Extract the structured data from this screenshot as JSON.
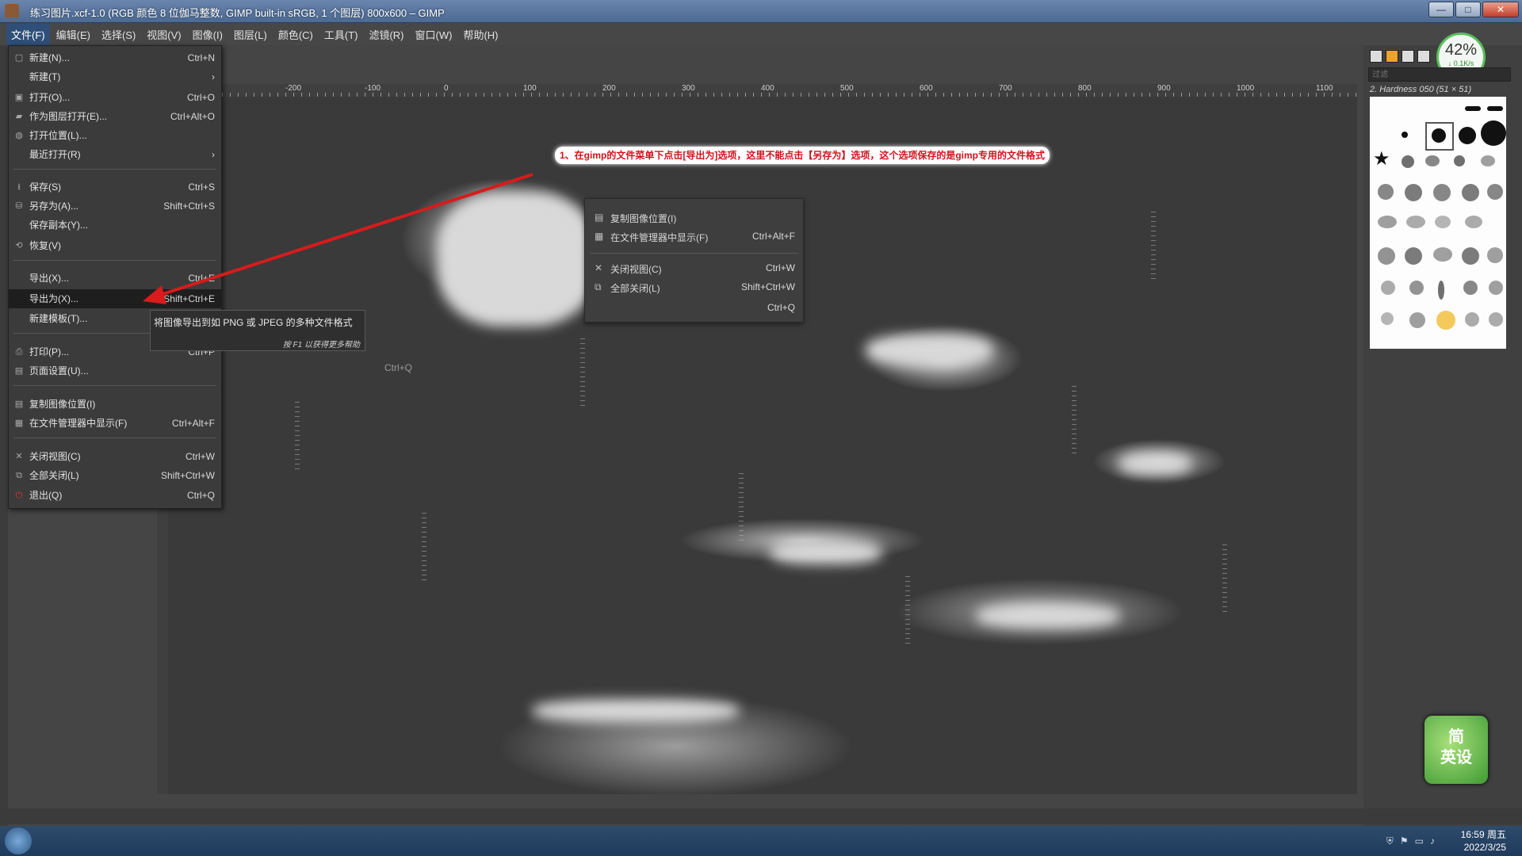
{
  "window": {
    "title": "练习图片.xcf-1.0 (RGB 颜色 8 位伽马整数, GIMP built-in sRGB, 1 个图层) 800x600 – GIMP",
    "buttons": [
      "—",
      "□",
      "✕"
    ]
  },
  "menubar": {
    "items": [
      {
        "label": "文件(F)",
        "active": true
      },
      {
        "label": "编辑(E)"
      },
      {
        "label": "选择(S)"
      },
      {
        "label": "视图(V)"
      },
      {
        "label": "图像(I)"
      },
      {
        "label": "图层(L)"
      },
      {
        "label": "颜色(C)"
      },
      {
        "label": "工具(T)"
      },
      {
        "label": "滤镜(R)"
      },
      {
        "label": "窗口(W)"
      },
      {
        "label": "帮助(H)"
      }
    ]
  },
  "file_menu": {
    "items": [
      {
        "label": "新建(N)...",
        "shortcut": "Ctrl+N",
        "icon": "new-icon"
      },
      {
        "label": "新建(T)",
        "shortcut": "›",
        "icon": ""
      },
      {
        "label": "打开(O)...",
        "shortcut": "Ctrl+O",
        "icon": "open-icon"
      },
      {
        "label": "作为图层打开(E)...",
        "shortcut": "Ctrl+Alt+O",
        "icon": "open-layer-icon"
      },
      {
        "label": "打开位置(L)...",
        "shortcut": "",
        "icon": "globe-icon"
      },
      {
        "label": "最近打开(R)",
        "shortcut": "›",
        "icon": ""
      },
      {
        "label": "保存(S)",
        "shortcut": "Ctrl+S",
        "icon": "save-icon"
      },
      {
        "label": "另存为(A)...",
        "shortcut": "Shift+Ctrl+S",
        "icon": "save-as-icon"
      },
      {
        "label": "保存副本(Y)...",
        "shortcut": "",
        "icon": ""
      },
      {
        "label": "恢复(V)",
        "shortcut": "",
        "icon": "revert-icon"
      },
      {
        "label": "导出(X)...",
        "shortcut": "Ctrl+E",
        "icon": ""
      },
      {
        "label": "导出为(X)...",
        "shortcut": "Shift+Ctrl+E",
        "icon": "",
        "highlighted": true
      },
      {
        "label": "新建模板(T)...",
        "shortcut": "",
        "icon": ""
      },
      {
        "label": "打印(P)...",
        "shortcut": "Ctrl+P",
        "icon": "print-icon"
      },
      {
        "label": "页面设置(U)...",
        "shortcut": "",
        "icon": "page-setup-icon"
      },
      {
        "label": "复制图像位置(I)",
        "shortcut": "",
        "icon": "copy-location-icon"
      },
      {
        "label": "在文件管理器中显示(F)",
        "shortcut": "Ctrl+Alt+F",
        "icon": "file-manager-icon"
      },
      {
        "label": "关闭视图(C)",
        "shortcut": "Ctrl+W",
        "icon": "close-icon"
      },
      {
        "label": "全部关闭(L)",
        "shortcut": "Shift+Ctrl+W",
        "icon": "close-all-icon"
      },
      {
        "label": "退出(Q)",
        "shortcut": "Ctrl+Q",
        "icon": "quit-icon"
      }
    ]
  },
  "tooltip": {
    "text": "将图像导出到如 PNG 或 JPEG 的多种文件格式",
    "hint": "按 F1 以获得更多帮助"
  },
  "ghost_menu": {
    "items": [
      {
        "label": "复制图像位置(I)",
        "shortcut": ""
      },
      {
        "label": "在文件管理器中显示(F)",
        "shortcut": "Ctrl+Alt+F"
      },
      {
        "label": "关闭视图(C)",
        "shortcut": "Ctrl+W"
      },
      {
        "label": "全部关闭(L)",
        "shortcut": "Shift+Ctrl+W"
      },
      {
        "label": "",
        "shortcut": "Ctrl+Q"
      }
    ],
    "stray_shortcut": "Ctrl+Q"
  },
  "annotation": {
    "text": "1、在gimp的文件菜单下点击[导出为]选项，这里不能点击【另存为】选项，这个选项保存的是gimp专用的文件格式"
  },
  "ruler": {
    "ticks": [
      "-200",
      "-100",
      "0",
      "100",
      "200",
      "300",
      "400",
      "500",
      "600",
      "700",
      "800",
      "900",
      "1000",
      "1100"
    ]
  },
  "dock": {
    "memory_percent": "42%",
    "memory_rate": "↓ 0.1K/s",
    "filter_placeholder": "过滤",
    "brush_name": "2. Hardness 050 (51 × 51)"
  },
  "watermark": {
    "line1": "简",
    "line2": "英设"
  },
  "taskbar": {
    "time": "16:59 周五",
    "date": "2022/3/25"
  },
  "colors": {
    "accent": "#2f4f78",
    "annotation": "#d2121d",
    "arrow": "#d81b1b"
  }
}
